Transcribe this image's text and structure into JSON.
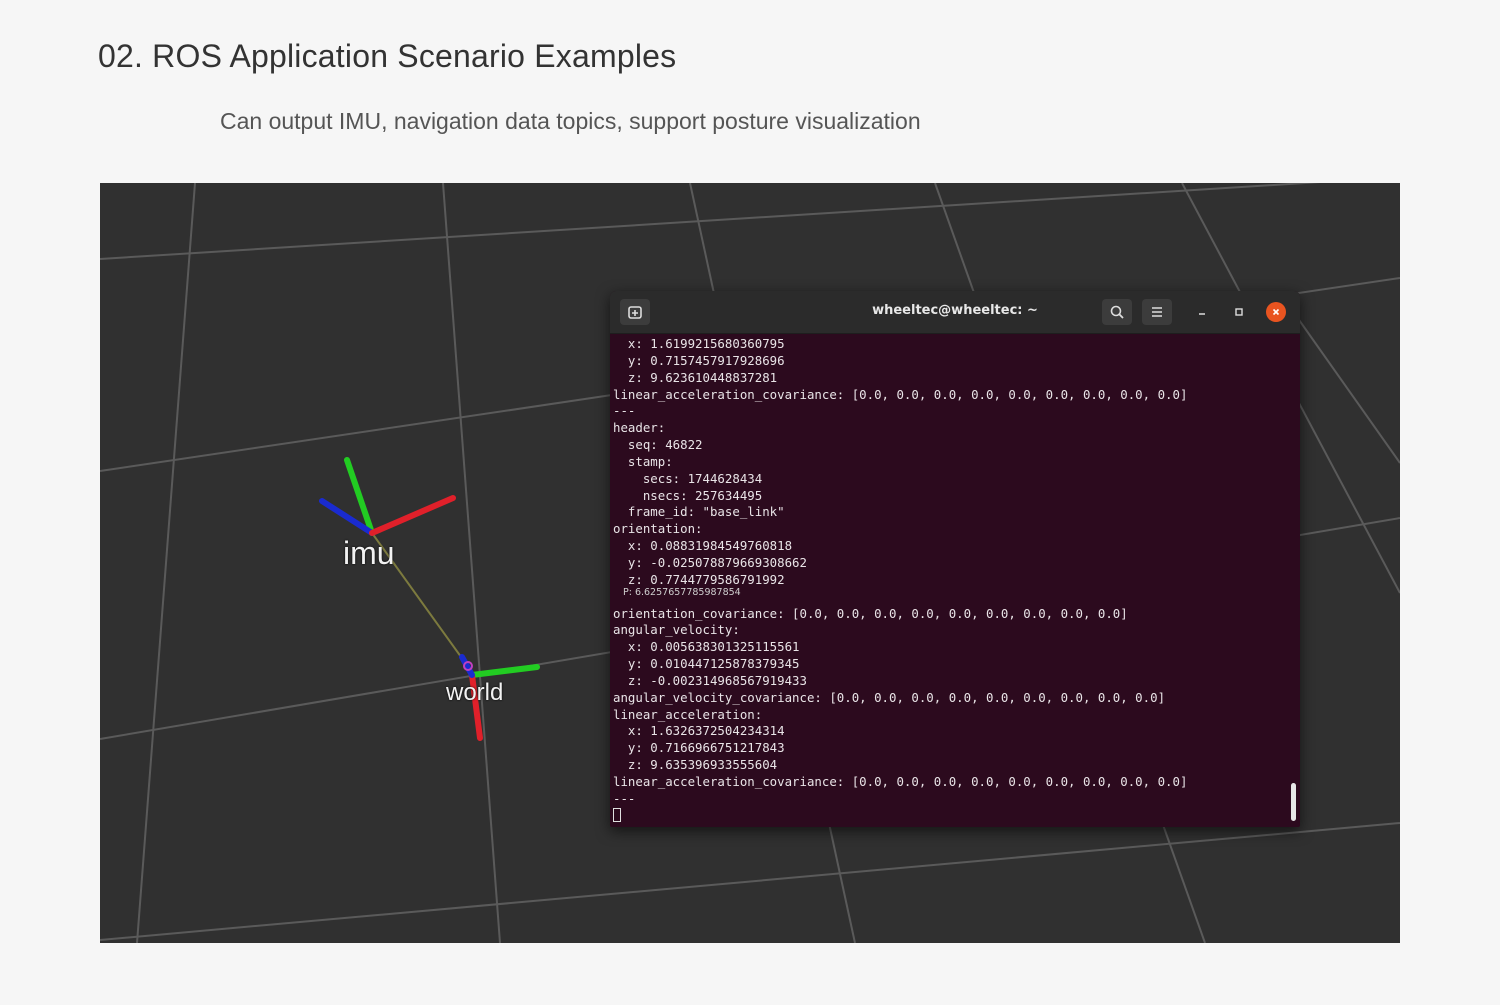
{
  "page": {
    "title": "02. ROS Application Scenario Examples",
    "subtitle": "Can output IMU, navigation data topics, support posture visualization"
  },
  "rviz": {
    "frames": [
      {
        "label": "imu"
      },
      {
        "label": "world"
      }
    ],
    "axis_colors": {
      "x": "#e0202a",
      "y": "#22cc22",
      "z": "#1a2bd0",
      "link": "#8a8a3a"
    }
  },
  "terminal": {
    "title": "wheeltec@wheeltec: ~",
    "tooltip": "P: 6.6257657785987854",
    "lines": [
      "  x: 1.6199215680360795",
      "  y: 0.7157457917928696",
      "  z: 9.623610448837281",
      "linear_acceleration_covariance: [0.0, 0.0, 0.0, 0.0, 0.0, 0.0, 0.0, 0.0, 0.0]",
      "---",
      "header:",
      "  seq: 46822",
      "  stamp:",
      "    secs: 1744628434",
      "    nsecs: 257634495",
      "  frame_id: \"base_link\"",
      "orientation:",
      "  x: 0.08831984549760818",
      "  y: -0.025078879669308662",
      "  z: 0.7744779586791992",
      "",
      "orientation_covariance: [0.0, 0.0, 0.0, 0.0, 0.0, 0.0, 0.0, 0.0, 0.0]",
      "angular_velocity:",
      "  x: 0.005638301325115561",
      "  y: 0.010447125878379345",
      "  z: -0.002314968567919433",
      "angular_velocity_covariance: [0.0, 0.0, 0.0, 0.0, 0.0, 0.0, 0.0, 0.0, 0.0]",
      "linear_acceleration:",
      "  x: 1.6326372504234314",
      "  y: 0.7166966751217843",
      "  z: 9.635396933555604",
      "linear_acceleration_covariance: [0.0, 0.0, 0.0, 0.0, 0.0, 0.0, 0.0, 0.0, 0.0]",
      "---"
    ]
  },
  "icons": {
    "new_tab": "new-tab-icon",
    "search": "search-icon",
    "menu": "hamburger-menu-icon",
    "minimize": "minimize-icon",
    "maximize": "maximize-icon",
    "close": "close-icon"
  },
  "colors": {
    "page_bg": "#f6f6f6",
    "viewport_bg": "#303030",
    "terminal_bg": "#2c0a1e",
    "close_button": "#e95420"
  }
}
